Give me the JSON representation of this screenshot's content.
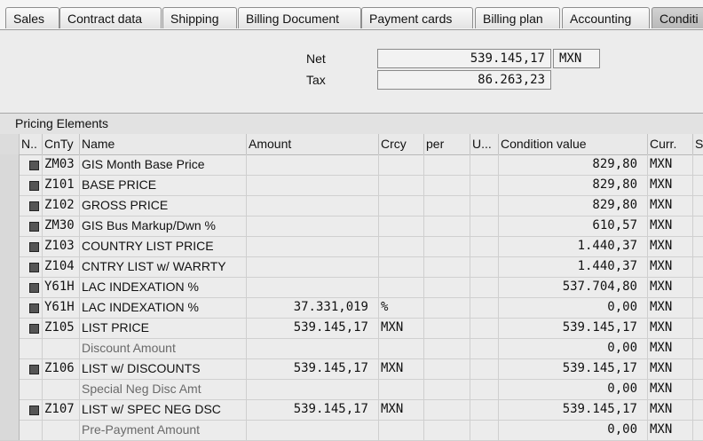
{
  "tabs": [
    {
      "label": "Sales"
    },
    {
      "label": "Contract data"
    },
    {
      "label": "Shipping"
    },
    {
      "label": "Billing Document"
    },
    {
      "label": "Payment cards"
    },
    {
      "label": "Billing plan"
    },
    {
      "label": "Accounting"
    },
    {
      "label": "Conditi"
    }
  ],
  "totals": {
    "net_label": "Net",
    "net_value": "539.145,17",
    "net_currency": "MXN",
    "tax_label": "Tax",
    "tax_value": "86.263,23"
  },
  "panel": {
    "title": "Pricing Elements"
  },
  "columns": {
    "n": "N..",
    "cnty": "CnTy",
    "name": "Name",
    "amount": "Amount",
    "crcy": "Crcy",
    "per": "per",
    "u": "U...",
    "cval": "Condition value",
    "curr": "Curr.",
    "s": "S"
  },
  "rows": [
    {
      "status": true,
      "cnty": "ZM03",
      "name": "GIS Month Base Price",
      "amount": "",
      "crcy": "",
      "cval": "829,80",
      "curr": "MXN"
    },
    {
      "status": true,
      "cnty": "Z101",
      "name": "BASE PRICE",
      "amount": "",
      "crcy": "",
      "cval": "829,80",
      "curr": "MXN"
    },
    {
      "status": true,
      "cnty": "Z102",
      "name": "GROSS PRICE",
      "amount": "",
      "crcy": "",
      "cval": "829,80",
      "curr": "MXN"
    },
    {
      "status": true,
      "cnty": "ZM30",
      "name": "GIS Bus Markup/Dwn %",
      "amount": "",
      "crcy": "",
      "cval": "610,57",
      "curr": "MXN"
    },
    {
      "status": true,
      "cnty": "Z103",
      "name": "COUNTRY LIST PRICE",
      "amount": "",
      "crcy": "",
      "cval": "1.440,37",
      "curr": "MXN"
    },
    {
      "status": true,
      "cnty": "Z104",
      "name": "CNTRY LIST w/ WARRTY",
      "amount": "",
      "crcy": "",
      "cval": "1.440,37",
      "curr": "MXN"
    },
    {
      "status": true,
      "cnty": "Y61H",
      "name": "LAC INDEXATION %",
      "amount": "",
      "crcy": "",
      "cval": "537.704,80",
      "curr": "MXN"
    },
    {
      "status": true,
      "cnty": "Y61H",
      "name": "LAC INDEXATION %",
      "amount": "37.331,019",
      "crcy": "%",
      "cval": "0,00",
      "curr": "MXN"
    },
    {
      "status": true,
      "cnty": "Z105",
      "name": "LIST PRICE",
      "amount": "539.145,17",
      "crcy": "MXN",
      "cval": "539.145,17",
      "curr": "MXN"
    },
    {
      "status": false,
      "cnty": "",
      "name": "Discount Amount",
      "amount": "",
      "crcy": "",
      "cval": "0,00",
      "curr": "MXN"
    },
    {
      "status": true,
      "cnty": "Z106",
      "name": "LIST w/ DISCOUNTS",
      "amount": "539.145,17",
      "crcy": "MXN",
      "cval": "539.145,17",
      "curr": "MXN"
    },
    {
      "status": false,
      "cnty": "",
      "name": "Special Neg Disc Amt",
      "amount": "",
      "crcy": "",
      "cval": "0,00",
      "curr": "MXN"
    },
    {
      "status": true,
      "cnty": "Z107",
      "name": "LIST w/ SPEC NEG DSC",
      "amount": "539.145,17",
      "crcy": "MXN",
      "cval": "539.145,17",
      "curr": "MXN"
    },
    {
      "status": false,
      "cnty": "",
      "name": "Pre-Payment Amount",
      "amount": "",
      "crcy": "",
      "cval": "0,00",
      "curr": "MXN"
    }
  ]
}
